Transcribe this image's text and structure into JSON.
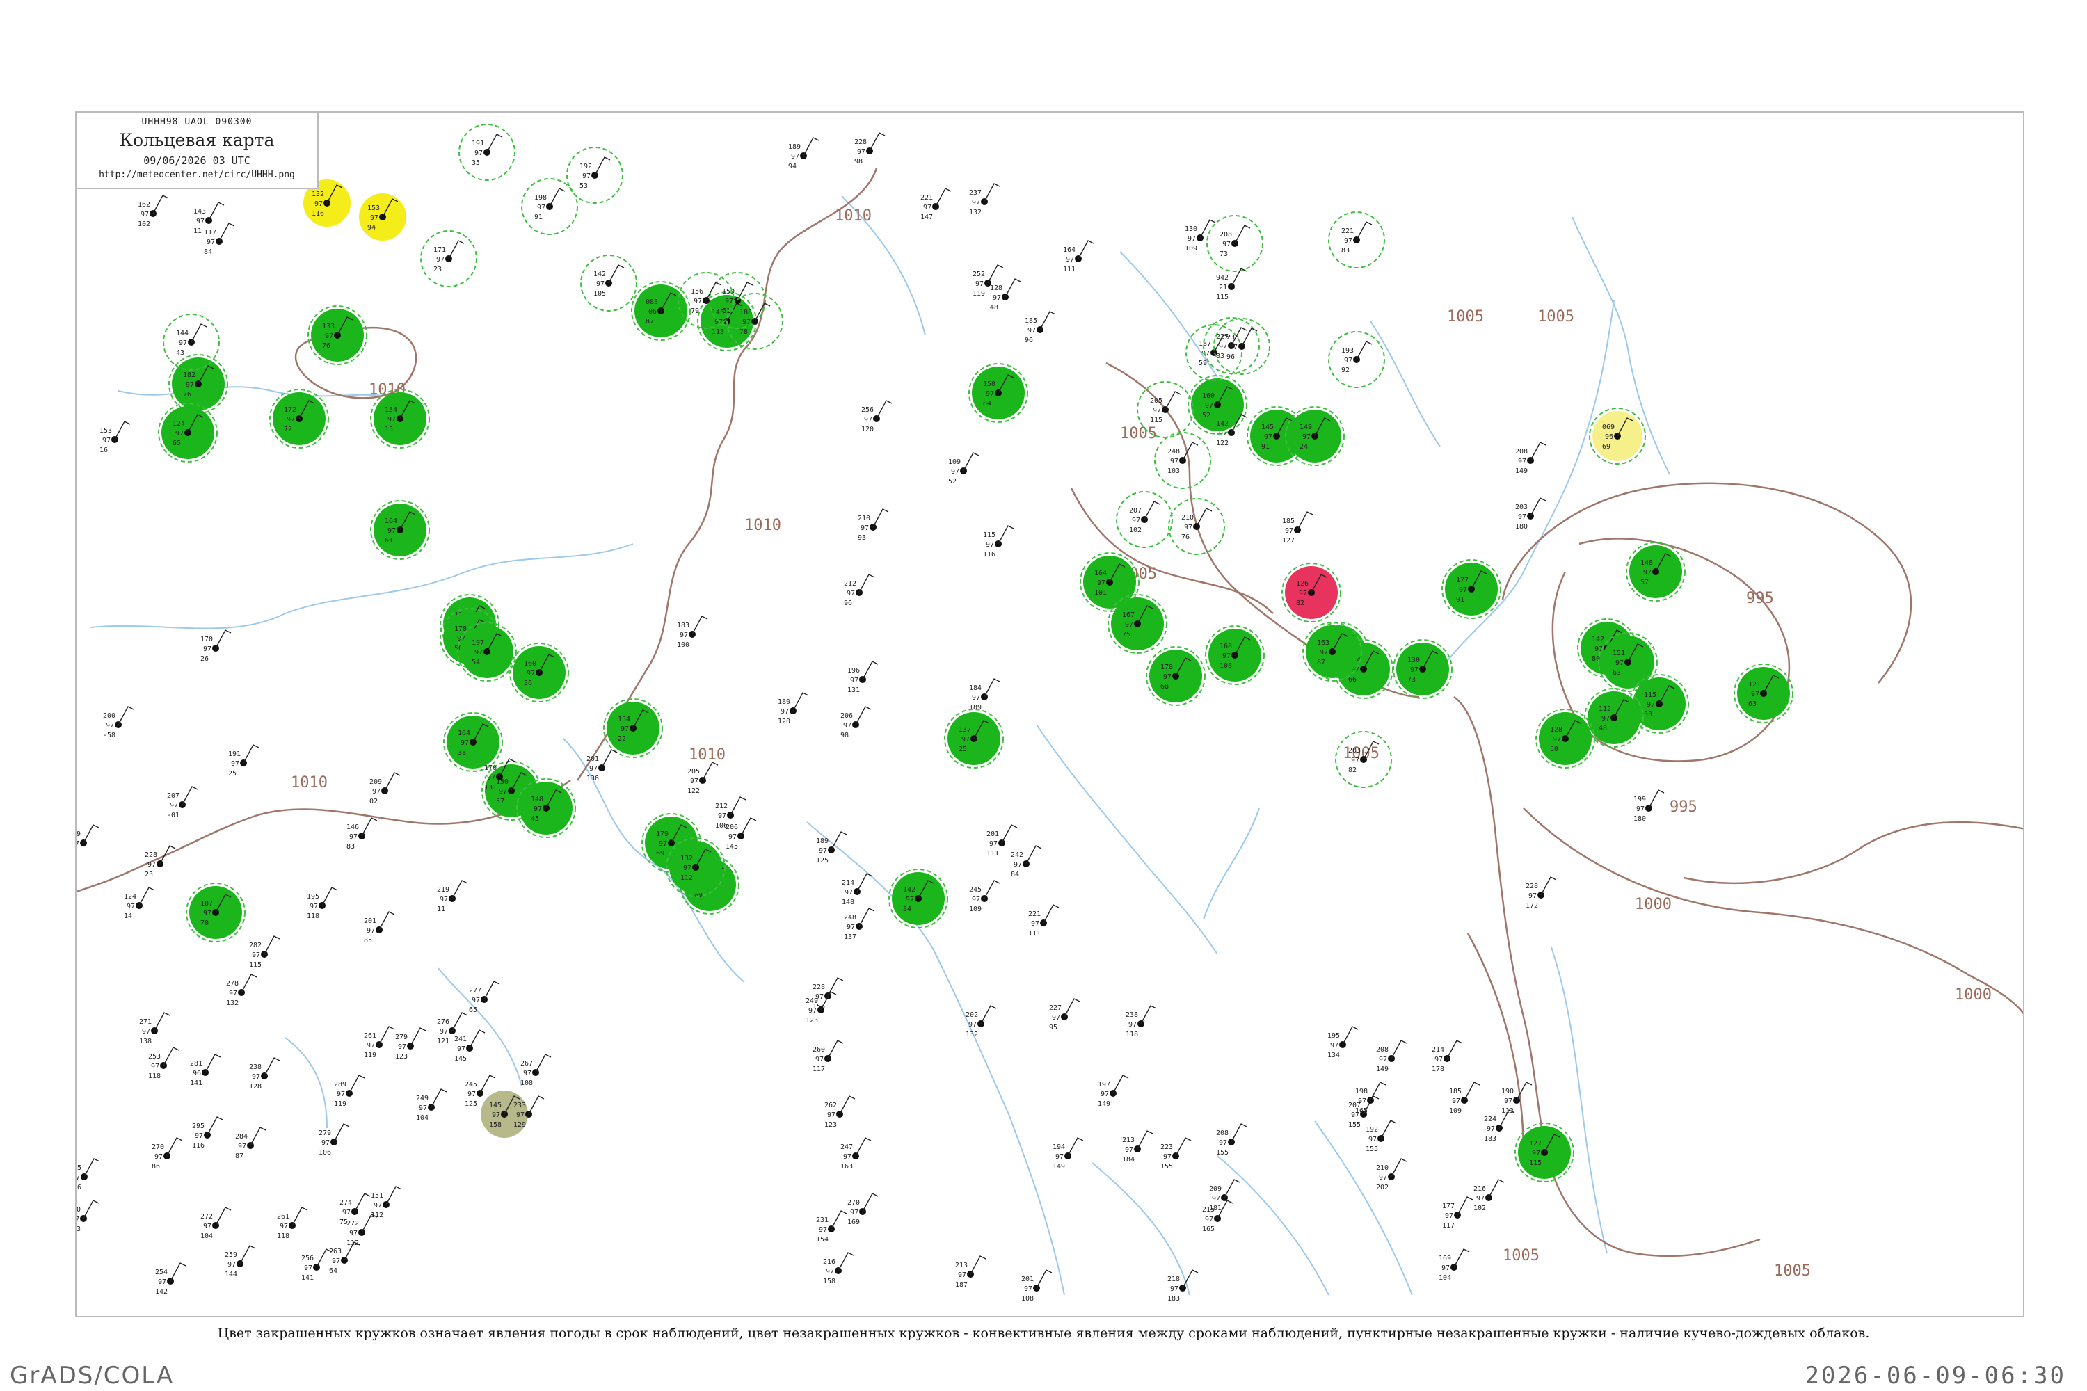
{
  "header": {
    "code": "UHHH98  UAOL  090300",
    "title": "Кольцевая карта",
    "date": "09/06/2026 03 UTC",
    "url": "http://meteocenter.net/circ/UHHH.png"
  },
  "caption": "Цвет закрашенных кружков означает явления погоды в срок наблюдений, цвет незакрашенных кружков - конвективные явления между сроками наблюдений, пунктирные незакрашенные кружки - наличие кучево-дождевых облаков.",
  "footer": {
    "left": "GrADS/COLA",
    "right": "2026-06-09-06:30"
  },
  "colors": {
    "isobar": "#a0766a",
    "river": "#9cc9ec",
    "rain_fill": "#1bb61b",
    "storm_fill": "#e8335f",
    "yellow_fill": "#f5ed1a",
    "light_yellow": "#f6f08a",
    "olive_fill": "#b7b98a",
    "cb_ring": "#3fbf3f"
  },
  "isobar_labels": [
    "1010",
    "1010",
    "1010",
    "1010",
    "1010",
    "1005",
    "1005",
    "1005",
    "1005",
    "1005",
    "1005",
    "995",
    "995",
    "1000",
    "1000",
    "1005"
  ],
  "stations": [
    {
      "t": "182",
      "p": "97",
      "d": "76",
      "mark": "filled-green"
    },
    {
      "t": "172",
      "p": "97",
      "d": "72",
      "mark": "filled-green"
    },
    {
      "t": "124",
      "p": "97",
      "d": "65",
      "mark": "filled-green"
    },
    {
      "t": "134",
      "p": "97",
      "d": "15",
      "mark": "filled-green"
    },
    {
      "t": "133",
      "p": "97",
      "d": "76",
      "mark": "filled-green"
    },
    {
      "t": "083",
      "p": "06",
      "d": "87",
      "mark": "filled-green"
    },
    {
      "t": "143",
      "p": "97",
      "d": "113",
      "mark": "filled-green"
    },
    {
      "t": "164",
      "p": "97",
      "d": "61",
      "mark": "filled-green"
    },
    {
      "t": "113",
      "p": "97",
      "d": "39",
      "mark": "filled-green"
    },
    {
      "t": "178",
      "p": "97",
      "d": "50",
      "mark": "filled-green"
    },
    {
      "t": "197",
      "p": "97",
      "d": "54",
      "mark": "filled-green"
    },
    {
      "t": "160",
      "p": "97",
      "d": "36",
      "mark": "filled-green"
    },
    {
      "t": "164",
      "p": "97",
      "d": "38",
      "mark": "filled-green"
    },
    {
      "t": "150",
      "p": "97",
      "d": "57",
      "mark": "filled-green"
    },
    {
      "t": "154",
      "p": "97",
      "d": "22",
      "mark": "filled-green"
    },
    {
      "t": "148",
      "p": "97",
      "d": "45",
      "mark": "filled-green"
    },
    {
      "t": "127",
      "p": "97",
      "d": "89",
      "mark": "filled-green"
    },
    {
      "t": "179",
      "p": "97",
      "d": "69",
      "mark": "filled-green"
    },
    {
      "t": "132",
      "p": "97",
      "d": "112",
      "mark": "filled-green"
    },
    {
      "t": "107",
      "p": "97",
      "d": "70",
      "mark": "filled-green"
    },
    {
      "t": "142",
      "p": "97",
      "d": "34",
      "mark": "filled-green"
    },
    {
      "t": "137",
      "p": "97",
      "d": "25",
      "mark": "filled-green"
    },
    {
      "t": "150",
      "p": "97",
      "d": "84",
      "mark": "filled-green"
    },
    {
      "t": "164",
      "p": "97",
      "d": "101",
      "mark": "filled-green"
    },
    {
      "t": "167",
      "p": "97",
      "d": "75",
      "mark": "filled-green"
    },
    {
      "t": "145",
      "p": "97",
      "d": "91",
      "mark": "filled-green"
    },
    {
      "t": "160",
      "p": "97",
      "d": "52",
      "mark": "filled-green"
    },
    {
      "t": "149",
      "p": "97",
      "d": "24",
      "mark": "filled-green"
    },
    {
      "t": "168",
      "p": "97",
      "d": "108",
      "mark": "filled-green"
    },
    {
      "t": "116",
      "p": "97",
      "d": "96",
      "mark": "filled-green"
    },
    {
      "t": "178",
      "p": "97",
      "d": "68",
      "mark": "filled-green"
    },
    {
      "t": "144",
      "p": "97",
      "d": "66",
      "mark": "filled-green"
    },
    {
      "t": "163",
      "p": "97",
      "d": "87",
      "mark": "filled-green"
    },
    {
      "t": "130",
      "p": "97",
      "d": "73",
      "mark": "filled-green"
    },
    {
      "t": "177",
      "p": "97",
      "d": "91",
      "mark": "filled-green"
    },
    {
      "t": "142",
      "p": "97",
      "d": "80",
      "mark": "filled-green"
    },
    {
      "t": "148",
      "p": "97",
      "d": "57",
      "mark": "filled-green"
    },
    {
      "t": "151",
      "p": "97",
      "d": "63",
      "mark": "filled-green"
    },
    {
      "t": "115",
      "p": "97",
      "d": "33",
      "mark": "filled-green"
    },
    {
      "t": "112",
      "p": "97",
      "d": "48",
      "mark": "filled-green"
    },
    {
      "t": "128",
      "p": "97",
      "d": "50",
      "mark": "filled-green"
    },
    {
      "t": "121",
      "p": "97",
      "d": "63",
      "mark": "filled-green"
    },
    {
      "t": "127",
      "p": "97",
      "d": "115",
      "mark": "filled-green"
    },
    {
      "t": "126",
      "p": "97",
      "d": "82",
      "mark": "filled-red"
    },
    {
      "t": "132",
      "p": "97",
      "d": "116",
      "mark": "filled-yellow"
    },
    {
      "t": "153",
      "p": "97",
      "d": "94",
      "mark": "filled-yellow"
    },
    {
      "t": "069",
      "p": "96",
      "d": "69",
      "mark": "filled-lightyellow"
    },
    {
      "t": "145",
      "p": "97",
      "d": "158",
      "mark": "filled-olive"
    },
    {
      "t": "191",
      "p": "97",
      "d": "35",
      "mark": "ring"
    },
    {
      "t": "192",
      "p": "97",
      "d": "53",
      "mark": "ring"
    },
    {
      "t": "198",
      "p": "97",
      "d": "91",
      "mark": "ring"
    },
    {
      "t": "171",
      "p": "97",
      "d": "23",
      "mark": "ring"
    },
    {
      "t": "144",
      "p": "97",
      "d": "43",
      "mark": "ring"
    },
    {
      "t": "208",
      "p": "97",
      "d": "73",
      "mark": "ring"
    },
    {
      "t": "221",
      "p": "97",
      "d": "83",
      "mark": "ring"
    },
    {
      "t": "187",
      "p": "97",
      "d": "59",
      "mark": "ring"
    },
    {
      "t": "227",
      "p": "97",
      "d": "83",
      "mark": "ring"
    },
    {
      "t": "235",
      "p": "97",
      "d": "96",
      "mark": "ring"
    },
    {
      "t": "193",
      "p": "97",
      "d": "92",
      "mark": "ring"
    },
    {
      "t": "210",
      "p": "97",
      "d": "76",
      "mark": "ring"
    },
    {
      "t": "205",
      "p": "97",
      "d": "115",
      "mark": "ring"
    },
    {
      "t": "248",
      "p": "97",
      "d": "103",
      "mark": "ring"
    },
    {
      "t": "207",
      "p": "97",
      "d": "102",
      "mark": "ring"
    },
    {
      "t": "203",
      "p": "97",
      "d": "82",
      "mark": "ring"
    },
    {
      "t": "142",
      "p": "97",
      "d": "105",
      "mark": "ring"
    },
    {
      "t": "159",
      "p": "97",
      "d": "61",
      "mark": "ring"
    },
    {
      "t": "156",
      "p": "97",
      "d": "79",
      "mark": "ring"
    },
    {
      "t": "188",
      "p": "97",
      "d": "78",
      "mark": "ring"
    },
    {
      "t": "153",
      "p": "97",
      "d": "16",
      "mark": "plain"
    },
    {
      "t": "143",
      "p": "97",
      "d": "11",
      "mark": "plain"
    },
    {
      "t": "162",
      "p": "97",
      "d": "102",
      "mark": "plain"
    },
    {
      "t": "117",
      "p": "97",
      "d": "84",
      "mark": "plain"
    },
    {
      "t": "189",
      "p": "97",
      "d": "94",
      "mark": "plain"
    },
    {
      "t": "228",
      "p": "97",
      "d": "98",
      "mark": "plain"
    },
    {
      "t": "237",
      "p": "97",
      "d": "132",
      "mark": "plain"
    },
    {
      "t": "221",
      "p": "97",
      "d": "147",
      "mark": "plain"
    },
    {
      "t": "256",
      "p": "97",
      "d": "120",
      "mark": "plain"
    },
    {
      "t": "210",
      "p": "97",
      "d": "93",
      "mark": "plain"
    },
    {
      "t": "212",
      "p": "97",
      "d": "96",
      "mark": "plain"
    },
    {
      "t": "196",
      "p": "97",
      "d": "131",
      "mark": "plain"
    },
    {
      "t": "206",
      "p": "97",
      "d": "98",
      "mark": "plain"
    },
    {
      "t": "180",
      "p": "97",
      "d": "120",
      "mark": "plain"
    },
    {
      "t": "205",
      "p": "97",
      "d": "122",
      "mark": "plain"
    },
    {
      "t": "183",
      "p": "97",
      "d": "100",
      "mark": "plain"
    },
    {
      "t": "170",
      "p": "97",
      "d": "26",
      "mark": "plain"
    },
    {
      "t": "200",
      "p": "97",
      "d": "-58",
      "mark": "plain"
    },
    {
      "t": "191",
      "p": "97",
      "d": "25",
      "mark": "plain"
    },
    {
      "t": "207",
      "p": "97",
      "d": "-01",
      "mark": "plain"
    },
    {
      "t": "209",
      "p": "97",
      "d": "02",
      "mark": "plain"
    },
    {
      "t": "228",
      "p": "97",
      "d": "23",
      "mark": "plain"
    },
    {
      "t": "124",
      "p": "97",
      "d": "14",
      "mark": "plain"
    },
    {
      "t": "282",
      "p": "97",
      "d": "115",
      "mark": "plain"
    },
    {
      "t": "278",
      "p": "97",
      "d": "132",
      "mark": "plain"
    },
    {
      "t": "271",
      "p": "97",
      "d": "138",
      "mark": "plain"
    },
    {
      "t": "253",
      "p": "97",
      "d": "118",
      "mark": "plain"
    },
    {
      "t": "281",
      "p": "96",
      "d": "141",
      "mark": "plain"
    },
    {
      "t": "238",
      "p": "97",
      "d": "128",
      "mark": "plain"
    },
    {
      "t": "295",
      "p": "97",
      "d": "116",
      "mark": "plain"
    },
    {
      "t": "284",
      "p": "97",
      "d": "87",
      "mark": "plain"
    },
    {
      "t": "270",
      "p": "97",
      "d": "86",
      "mark": "plain"
    },
    {
      "t": "279",
      "p": "97",
      "d": "106",
      "mark": "plain"
    },
    {
      "t": "265",
      "p": "97",
      "d": "146",
      "mark": "plain"
    },
    {
      "t": "260",
      "p": "97",
      "d": "123",
      "mark": "plain"
    },
    {
      "t": "272",
      "p": "97",
      "d": "104",
      "mark": "plain"
    },
    {
      "t": "261",
      "p": "97",
      "d": "118",
      "mark": "plain"
    },
    {
      "t": "254",
      "p": "97",
      "d": "142",
      "mark": "plain"
    },
    {
      "t": "259",
      "p": "97",
      "d": "144",
      "mark": "plain"
    },
    {
      "t": "256",
      "p": "97",
      "d": "141",
      "mark": "plain"
    },
    {
      "t": "263",
      "p": "97",
      "d": "64",
      "mark": "plain"
    },
    {
      "t": "272",
      "p": "97",
      "d": "112",
      "mark": "plain"
    },
    {
      "t": "274",
      "p": "97",
      "d": "75",
      "mark": "plain"
    },
    {
      "t": "151",
      "p": "97",
      "d": "112",
      "mark": "plain"
    },
    {
      "t": "289",
      "p": "97",
      "d": "119",
      "mark": "plain"
    },
    {
      "t": "261",
      "p": "97",
      "d": "119",
      "mark": "plain"
    },
    {
      "t": "279",
      "p": "97",
      "d": "123",
      "mark": "plain"
    },
    {
      "t": "241",
      "p": "97",
      "d": "145",
      "mark": "plain"
    },
    {
      "t": "245",
      "p": "97",
      "d": "125",
      "mark": "plain"
    },
    {
      "t": "249",
      "p": "97",
      "d": "104",
      "mark": "plain"
    },
    {
      "t": "233",
      "p": "97",
      "d": "129",
      "mark": "plain"
    },
    {
      "t": "267",
      "p": "97",
      "d": "108",
      "mark": "plain"
    },
    {
      "t": "276",
      "p": "97",
      "d": "121",
      "mark": "plain"
    },
    {
      "t": "277",
      "p": "97",
      "d": "65",
      "mark": "plain"
    },
    {
      "t": "195",
      "p": "97",
      "d": "118",
      "mark": "plain"
    },
    {
      "t": "201",
      "p": "97",
      "d": "85",
      "mark": "plain"
    },
    {
      "t": "146",
      "p": "97",
      "d": "83",
      "mark": "plain"
    },
    {
      "t": "219",
      "p": "97",
      "d": "11",
      "mark": "plain"
    },
    {
      "t": "209",
      "p": "97",
      "d": "02",
      "mark": "plain"
    },
    {
      "t": "170",
      "p": "97",
      "d": "131",
      "mark": "plain"
    },
    {
      "t": "201",
      "p": "97",
      "d": "136",
      "mark": "plain"
    },
    {
      "t": "206",
      "p": "97",
      "d": "145",
      "mark": "plain"
    },
    {
      "t": "212",
      "p": "97",
      "d": "106",
      "mark": "plain"
    },
    {
      "t": "189",
      "p": "97",
      "d": "125",
      "mark": "plain"
    },
    {
      "t": "214",
      "p": "97",
      "d": "148",
      "mark": "plain"
    },
    {
      "t": "248",
      "p": "97",
      "d": "137",
      "mark": "plain"
    },
    {
      "t": "228",
      "p": "97",
      "d": "156",
      "mark": "plain"
    },
    {
      "t": "249",
      "p": "97",
      "d": "123",
      "mark": "plain"
    },
    {
      "t": "260",
      "p": "97",
      "d": "117",
      "mark": "plain"
    },
    {
      "t": "262",
      "p": "97",
      "d": "123",
      "mark": "plain"
    },
    {
      "t": "247",
      "p": "97",
      "d": "163",
      "mark": "plain"
    },
    {
      "t": "270",
      "p": "97",
      "d": "169",
      "mark": "plain"
    },
    {
      "t": "231",
      "p": "97",
      "d": "154",
      "mark": "plain"
    },
    {
      "t": "216",
      "p": "97",
      "d": "158",
      "mark": "plain"
    },
    {
      "t": "213",
      "p": "97",
      "d": "187",
      "mark": "plain"
    },
    {
      "t": "201",
      "p": "97",
      "d": "108",
      "mark": "plain"
    },
    {
      "t": "194",
      "p": "97",
      "d": "149",
      "mark": "plain"
    },
    {
      "t": "197",
      "p": "97",
      "d": "149",
      "mark": "plain"
    },
    {
      "t": "213",
      "p": "97",
      "d": "184",
      "mark": "plain"
    },
    {
      "t": "218",
      "p": "97",
      "d": "183",
      "mark": "plain"
    },
    {
      "t": "215",
      "p": "97",
      "d": "165",
      "mark": "plain"
    },
    {
      "t": "209",
      "p": "97",
      "d": "181",
      "mark": "plain"
    },
    {
      "t": "223",
      "p": "97",
      "d": "155",
      "mark": "plain"
    },
    {
      "t": "208",
      "p": "97",
      "d": "155",
      "mark": "plain"
    },
    {
      "t": "207",
      "p": "97",
      "d": "155",
      "mark": "plain"
    },
    {
      "t": "192",
      "p": "97",
      "d": "155",
      "mark": "plain"
    },
    {
      "t": "198",
      "p": "97",
      "d": "165",
      "mark": "plain"
    },
    {
      "t": "195",
      "p": "97",
      "d": "134",
      "mark": "plain"
    },
    {
      "t": "208",
      "p": "97",
      "d": "149",
      "mark": "plain"
    },
    {
      "t": "214",
      "p": "97",
      "d": "178",
      "mark": "plain"
    },
    {
      "t": "210",
      "p": "97",
      "d": "202",
      "mark": "plain"
    },
    {
      "t": "224",
      "p": "97",
      "d": "183",
      "mark": "plain"
    },
    {
      "t": "190",
      "p": "97",
      "d": "113",
      "mark": "plain"
    },
    {
      "t": "185",
      "p": "97",
      "d": "109",
      "mark": "plain"
    },
    {
      "t": "177",
      "p": "97",
      "d": "117",
      "mark": "plain"
    },
    {
      "t": "169",
      "p": "97",
      "d": "104",
      "mark": "plain"
    },
    {
      "t": "216",
      "p": "97",
      "d": "102",
      "mark": "plain"
    },
    {
      "t": "227",
      "p": "97",
      "d": "95",
      "mark": "plain"
    },
    {
      "t": "202",
      "p": "97",
      "d": "132",
      "mark": "plain"
    },
    {
      "t": "238",
      "p": "97",
      "d": "118",
      "mark": "plain"
    },
    {
      "t": "245",
      "p": "97",
      "d": "109",
      "mark": "plain"
    },
    {
      "t": "221",
      "p": "97",
      "d": "111",
      "mark": "plain"
    },
    {
      "t": "242",
      "p": "97",
      "d": "84",
      "mark": "plain"
    },
    {
      "t": "201",
      "p": "97",
      "d": "111",
      "mark": "plain"
    },
    {
      "t": "184",
      "p": "97",
      "d": "189",
      "mark": "plain"
    },
    {
      "t": "115",
      "p": "97",
      "d": "116",
      "mark": "plain"
    },
    {
      "t": "109",
      "p": "97",
      "d": "52",
      "mark": "plain"
    },
    {
      "t": "252",
      "p": "97",
      "d": "119",
      "mark": "plain"
    },
    {
      "t": "185",
      "p": "97",
      "d": "96",
      "mark": "plain"
    },
    {
      "t": "128",
      "p": "97",
      "d": "48",
      "mark": "plain"
    },
    {
      "t": "164",
      "p": "97",
      "d": "111",
      "mark": "plain"
    },
    {
      "t": "130",
      "p": "97",
      "d": "109",
      "mark": "plain"
    },
    {
      "t": "942",
      "p": "21",
      "d": "115",
      "mark": "plain"
    },
    {
      "t": "142",
      "p": "97",
      "d": "122",
      "mark": "plain"
    },
    {
      "t": "185",
      "p": "97",
      "d": "127",
      "mark": "plain"
    },
    {
      "t": "203",
      "p": "97",
      "d": "180",
      "mark": "plain"
    },
    {
      "t": "208",
      "p": "97",
      "d": "149",
      "mark": "plain"
    },
    {
      "t": "199",
      "p": "97",
      "d": "180",
      "mark": "plain"
    },
    {
      "t": "228",
      "p": "97",
      "d": "172",
      "mark": "plain"
    }
  ]
}
